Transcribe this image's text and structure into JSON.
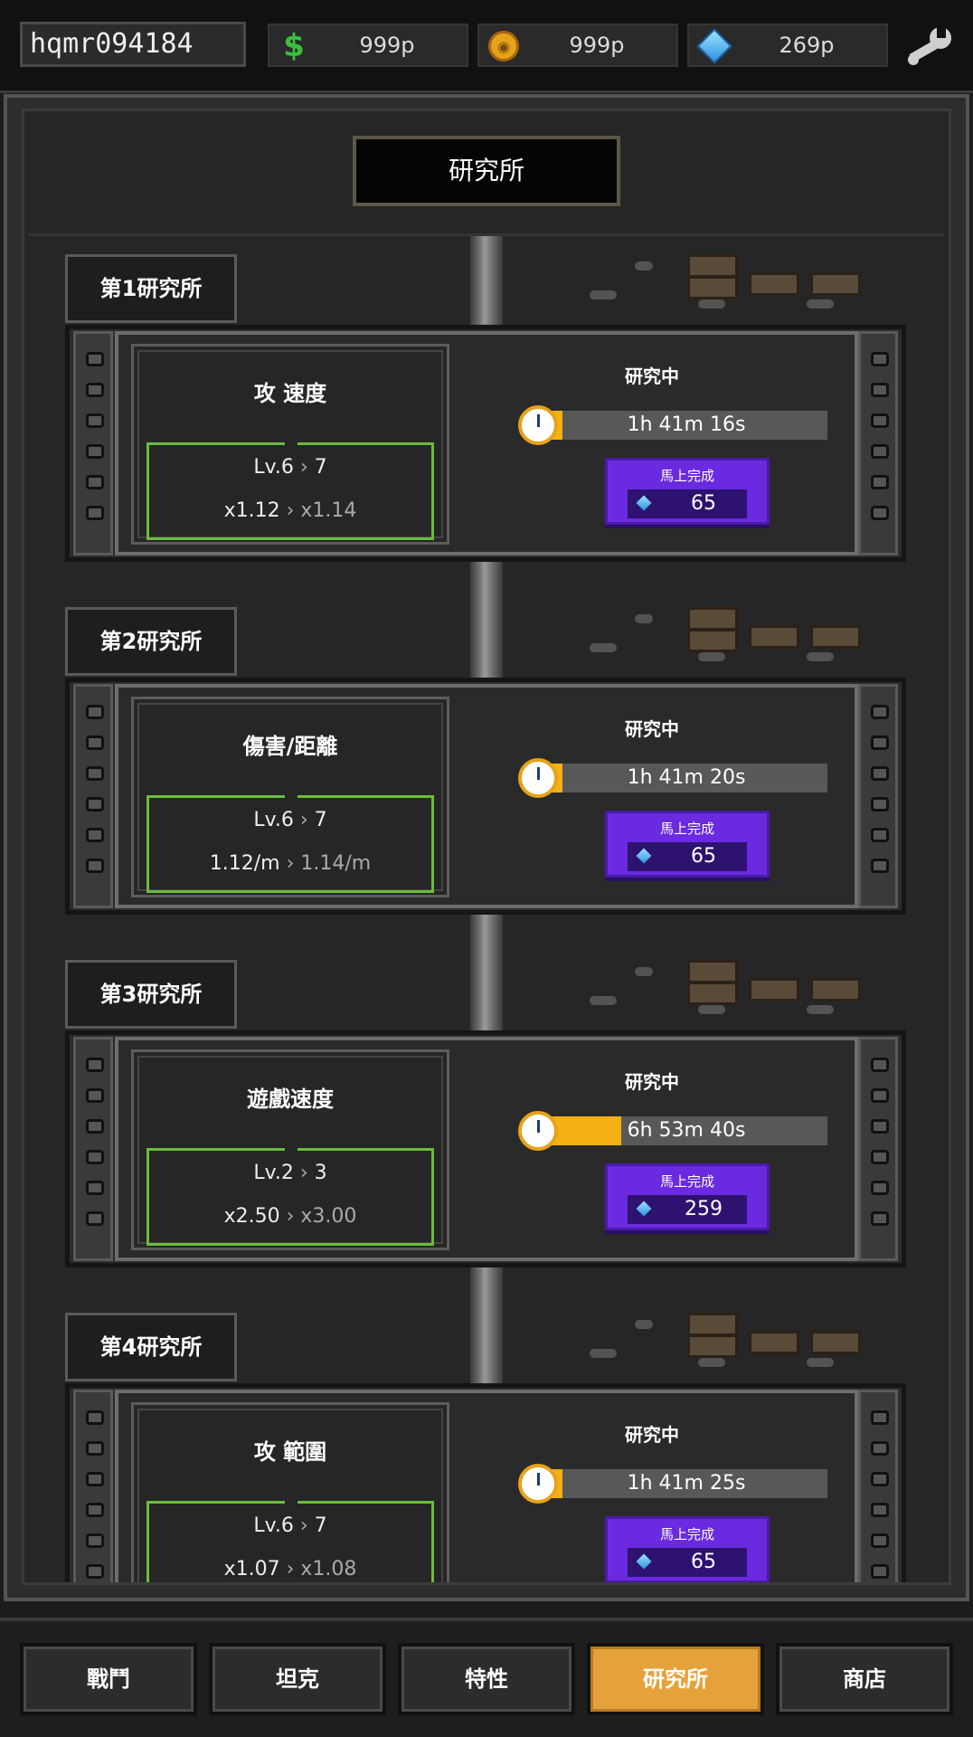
{
  "header": {
    "username": "hqmr094184",
    "cash": "999p",
    "coins": "999p",
    "gems": "269p",
    "icons": [
      "dollar-icon",
      "coin-icon",
      "gem-icon",
      "wrench-icon"
    ]
  },
  "page": {
    "title": "研究所"
  },
  "labs": [
    {
      "label": "第1研究所",
      "skill": "攻 速度",
      "level_from": "Lv.6",
      "level_to": "7",
      "value_from": "x1.12",
      "value_to": "x1.14",
      "status": "研究中",
      "time_left": "1h 41m 16s",
      "progress": 0.06,
      "finish_label": "馬上完成",
      "finish_cost": "65"
    },
    {
      "label": "第2研究所",
      "skill": "傷害/距離",
      "level_from": "Lv.6",
      "level_to": "7",
      "value_from": "1.12/m",
      "value_to": "1.14/m",
      "status": "研究中",
      "time_left": "1h 41m 20s",
      "progress": 0.06,
      "finish_label": "馬上完成",
      "finish_cost": "65"
    },
    {
      "label": "第3研究所",
      "skill": "遊戲速度",
      "level_from": "Lv.2",
      "level_to": "3",
      "value_from": "x2.50",
      "value_to": "x3.00",
      "status": "研究中",
      "time_left": "6h 53m 40s",
      "progress": 0.27,
      "finish_label": "馬上完成",
      "finish_cost": "259"
    },
    {
      "label": "第4研究所",
      "skill": "攻 範圍",
      "level_from": "Lv.6",
      "level_to": "7",
      "value_from": "x1.07",
      "value_to": "x1.08",
      "status": "研究中",
      "time_left": "1h 41m 25s",
      "progress": 0.06,
      "finish_label": "馬上完成",
      "finish_cost": "65"
    }
  ],
  "nav": {
    "items": [
      "戰鬥",
      "坦克",
      "特性",
      "研究所",
      "商店"
    ],
    "active": "研究所"
  },
  "colors": {
    "accent": "#e6a23a",
    "progress": "#f5b014",
    "finish_button": "#6a2ae0",
    "stat_border": "#6bbd3a"
  }
}
